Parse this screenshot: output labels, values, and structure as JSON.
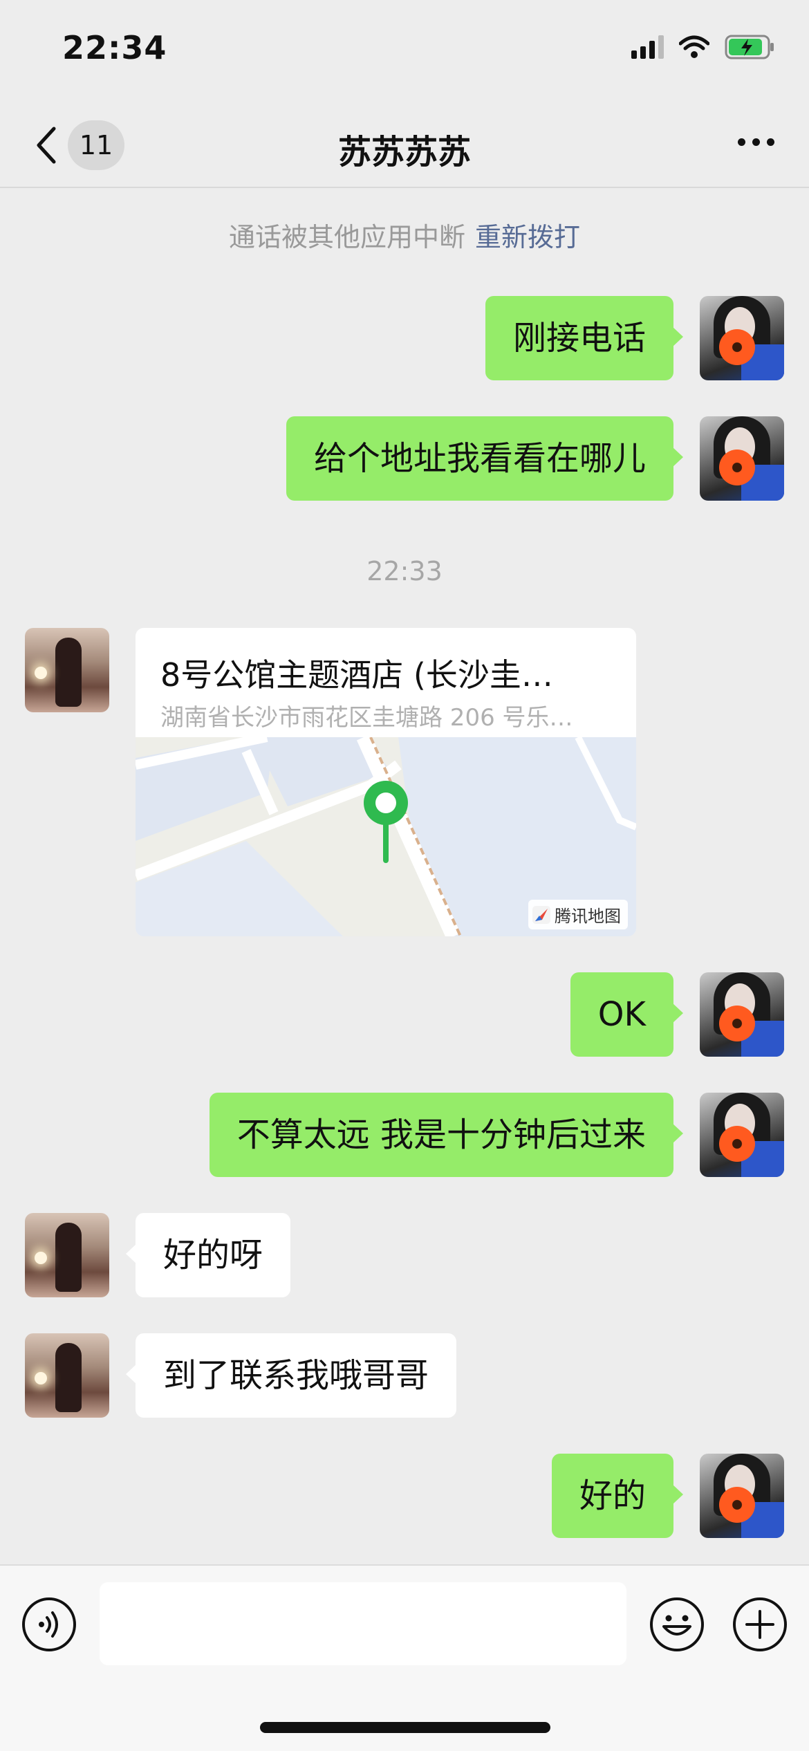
{
  "status_bar": {
    "time": "22:34"
  },
  "navbar": {
    "back_count": "11",
    "title": "苏苏苏苏"
  },
  "system_note": {
    "text": "通话被其他应用中断",
    "action": "重新拨打"
  },
  "timestamp": "22:33",
  "messages": [
    {
      "from": "me",
      "text": "刚接电话"
    },
    {
      "from": "me",
      "text": "给个地址我看看在哪儿"
    },
    {
      "from": "her",
      "type": "location",
      "title": "8号公馆主题酒店 (长沙圭…",
      "address": "湖南省长沙市雨花区圭塘路 206 号乐…",
      "map_brand": "腾讯地图"
    },
    {
      "from": "me",
      "text": "OK"
    },
    {
      "from": "me",
      "text": "不算太远 我是十分钟后过来"
    },
    {
      "from": "her",
      "text": "好的呀"
    },
    {
      "from": "her",
      "text": "到了联系我哦哥哥"
    },
    {
      "from": "me",
      "text": "好的"
    }
  ],
  "input_bar": {
    "placeholder": ""
  },
  "icons": [
    "back-icon",
    "more-icon",
    "voice-icon",
    "emoji-icon",
    "plus-icon",
    "location-pin-icon",
    "signal-icon",
    "wifi-icon",
    "battery-icon"
  ],
  "colors": {
    "my_bubble": "#95ec69",
    "her_bubble": "#ffffff",
    "link": "#576b95",
    "pin": "#2fba4f",
    "background": "#ededed"
  }
}
